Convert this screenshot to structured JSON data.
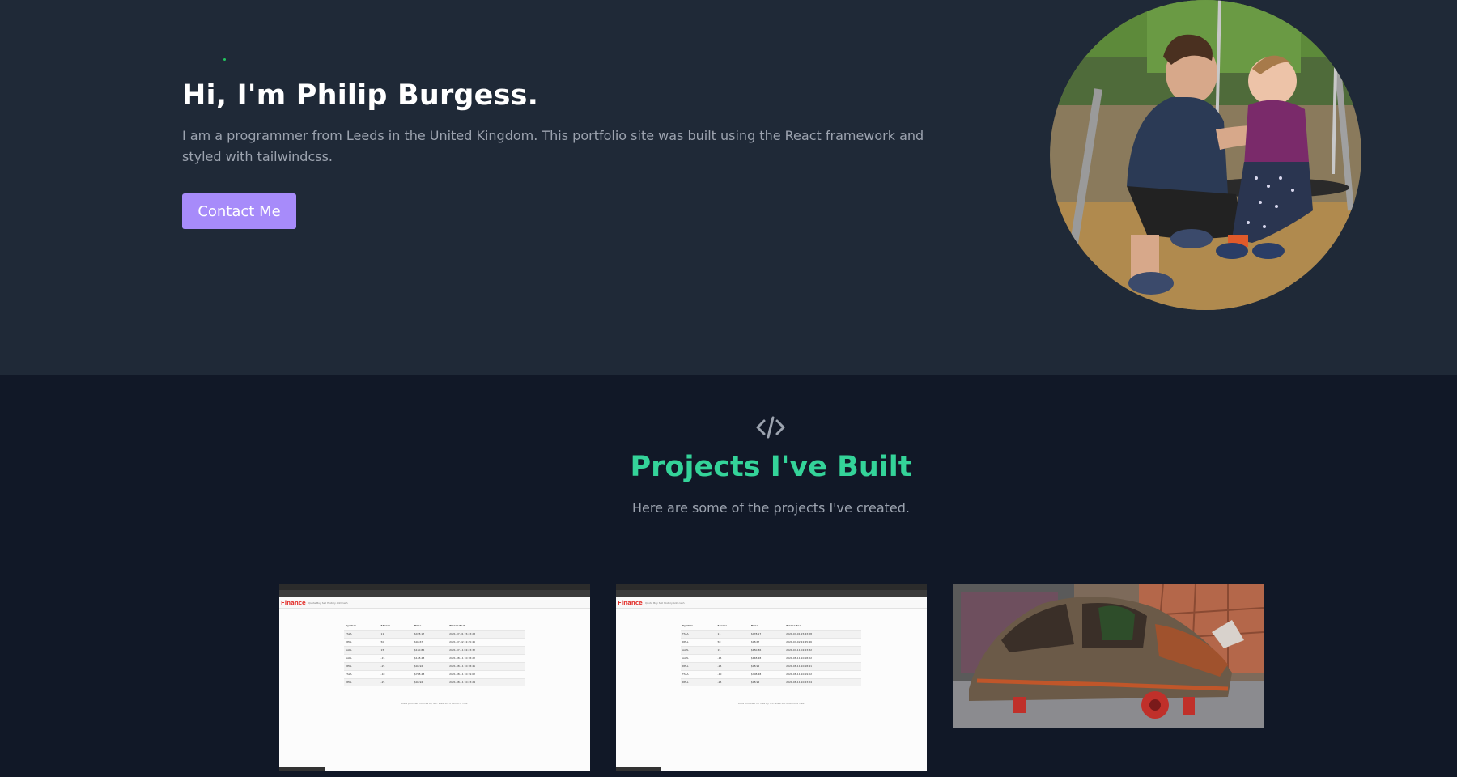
{
  "hero": {
    "title": "Hi, I'm Philip Burgess.",
    "description": "I am a programmer from Leeds in the United Kingdom. This portfolio site was built using the React framework and styled with tailwindcss.",
    "contact_label": "Contact Me",
    "accent_color": "#a78bfa"
  },
  "projects": {
    "icon": "code-icon",
    "title": "Projects I've Built",
    "subtitle": "Here are some of the projects I've created.",
    "title_color": "#34d399",
    "cards": [
      {
        "image": "finance-app-screenshot",
        "app_name": "Finance",
        "nav_links": "Quote  Buy  Sell  History  Add cash",
        "columns": [
          "Symbol",
          "Shares",
          "Price",
          "Transacted"
        ],
        "rows": [
          [
            "TSLA",
            "11",
            "$478.17",
            "2021-07-01 15:43:28"
          ],
          [
            "DELL",
            "50",
            "$98.67",
            "2021-07-02 22:45:46"
          ],
          [
            "AAPL",
            "15",
            "$150.86",
            "2021-07-11 02:23:32"
          ],
          [
            "AAPL",
            "-15",
            "$148.48",
            "2021-08-11 10:18:22"
          ],
          [
            "DELL",
            "-25",
            "$98.92",
            "2021-08-11 10:18:41"
          ],
          [
            "TSLA",
            "-10",
            "$708.48",
            "2021-08-11 10:19:02"
          ],
          [
            "DELL",
            "-25",
            "$98.92",
            "2021-08-11 10:23:24"
          ]
        ],
        "footer": "Data provided for free by IEX. View IEX's Terms of Use."
      },
      {
        "image": "finance-app-screenshot",
        "app_name": "Finance",
        "nav_links": "Quote  Buy  Sell  History  Add cash",
        "columns": [
          "Symbol",
          "Shares",
          "Price",
          "Transacted"
        ],
        "rows": [
          [
            "TSLA",
            "11",
            "$478.17",
            "2021-07-01 15:43:28"
          ],
          [
            "DELL",
            "50",
            "$98.67",
            "2021-07-02 22:45:46"
          ],
          [
            "AAPL",
            "15",
            "$150.86",
            "2021-07-11 02:23:32"
          ],
          [
            "AAPL",
            "-15",
            "$148.48",
            "2021-08-11 10:18:22"
          ],
          [
            "DELL",
            "-25",
            "$98.92",
            "2021-08-11 10:18:41"
          ],
          [
            "TSLA",
            "-10",
            "$708.48",
            "2021-08-11 10:19:02"
          ],
          [
            "DELL",
            "-25",
            "$98.92",
            "2021-08-11 10:23:24"
          ]
        ],
        "footer": "Data provided for free by IEX. View IEX's Terms of Use."
      },
      {
        "image": "rusty-car-photo"
      }
    ]
  }
}
